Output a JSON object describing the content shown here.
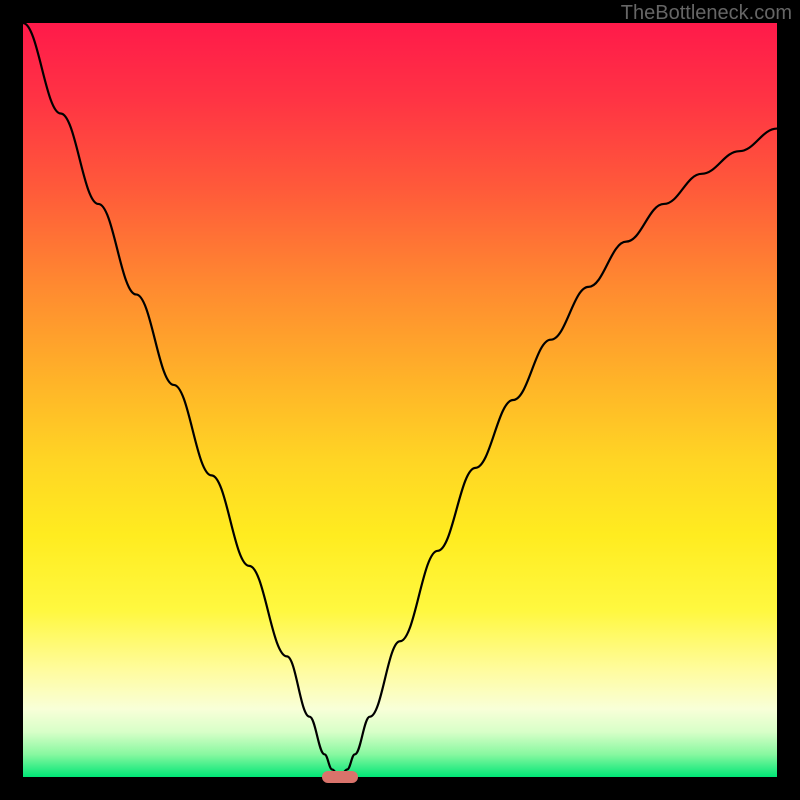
{
  "watermark": "TheBottleneck.com",
  "chart_data": {
    "type": "line",
    "title": "",
    "xlabel": "",
    "ylabel": "",
    "x_range": [
      0,
      100
    ],
    "y_range": [
      0,
      100
    ],
    "description": "V-shaped bottleneck curve showing deviation from optimal, minimum at x≈42",
    "optimal_x": 42,
    "series": [
      {
        "name": "bottleneck-curve",
        "x": [
          0,
          5,
          10,
          15,
          20,
          25,
          30,
          35,
          38,
          40,
          41,
          42,
          43,
          44,
          46,
          50,
          55,
          60,
          65,
          70,
          75,
          80,
          85,
          90,
          95,
          100
        ],
        "y": [
          100,
          88,
          76,
          64,
          52,
          40,
          28,
          16,
          8,
          3,
          1,
          0,
          1,
          3,
          8,
          18,
          30,
          41,
          50,
          58,
          65,
          71,
          76,
          80,
          83,
          86
        ]
      }
    ],
    "gradient_stops": [
      {
        "offset": 0,
        "color": "#ff1744"
      },
      {
        "offset": 20,
        "color": "#ff5533"
      },
      {
        "offset": 40,
        "color": "#ffa528"
      },
      {
        "offset": 55,
        "color": "#ffd924"
      },
      {
        "offset": 70,
        "color": "#fff022"
      },
      {
        "offset": 85,
        "color": "#fffcc0"
      },
      {
        "offset": 92,
        "color": "#f0ffd0"
      },
      {
        "offset": 97,
        "color": "#a0ffb0"
      },
      {
        "offset": 100,
        "color": "#00e676"
      }
    ],
    "marker": {
      "x_percent": 42,
      "color": "#d9736b"
    }
  }
}
